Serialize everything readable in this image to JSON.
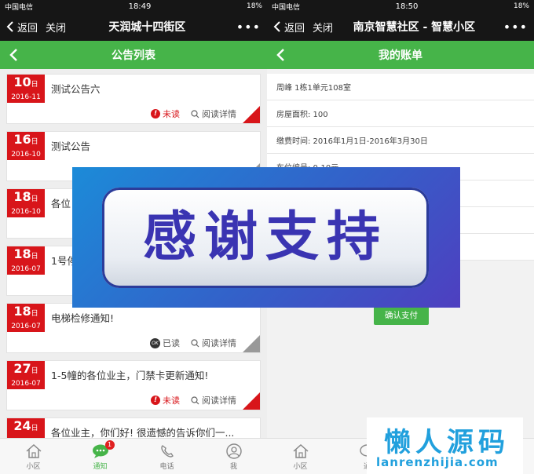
{
  "left": {
    "status": {
      "carrier": "中国电信",
      "time": "18:49",
      "battery": "18%"
    },
    "wx": {
      "back": "返回",
      "close": "关闭",
      "title": "天润城十四街区",
      "more": "•••"
    },
    "header": {
      "title": "公告列表"
    },
    "notices": [
      {
        "day": "10",
        "day_unit": "日",
        "ym": "2016-11",
        "title": "测试公告六",
        "status": "未读",
        "read_link": "阅读详情",
        "state": "unread"
      },
      {
        "day": "16",
        "day_unit": "日",
        "ym": "2016-10",
        "title": "测试公告",
        "status": "",
        "read_link": "",
        "state": "read"
      },
      {
        "day": "18",
        "day_unit": "日",
        "ym": "2016-10",
        "title": "各位",
        "status": "",
        "read_link": "",
        "state": "read"
      },
      {
        "day": "18",
        "day_unit": "日",
        "ym": "2016-07",
        "title": "1号停",
        "status": "",
        "read_link": "",
        "state": "read"
      },
      {
        "day": "18",
        "day_unit": "日",
        "ym": "2016-07",
        "title": "电梯检修通知!",
        "status": "已读",
        "read_link": "阅读详情",
        "state": "read"
      },
      {
        "day": "27",
        "day_unit": "日",
        "ym": "2016-07",
        "title": "1-5幢的各位业主，门禁卡更新通知!",
        "status": "未读",
        "read_link": "阅读详情",
        "state": "unread"
      },
      {
        "day": "24",
        "day_unit": "日",
        "ym": "",
        "title": "各位业主，你们好! 很遗憾的告诉你们一...",
        "status": "",
        "read_link": "",
        "state": "read"
      }
    ],
    "tabs": [
      {
        "label": "小区",
        "icon": "home-icon"
      },
      {
        "label": "通知",
        "icon": "chat-icon",
        "badge": "1"
      },
      {
        "label": "电话",
        "icon": "phone-icon"
      },
      {
        "label": "我",
        "icon": "user-icon"
      }
    ]
  },
  "right": {
    "status": {
      "carrier": "中国电信",
      "time": "18:50",
      "battery": "18%"
    },
    "wx": {
      "back": "返回",
      "close": "关闭",
      "title": "南京智慧社区 - 智慧小区",
      "more": "•••"
    },
    "header": {
      "title": "我的账单"
    },
    "rows": [
      "周峰  1栋1单元108室",
      "房屋面积: 100",
      "缴费时间: 2016年1月1日-2016年3月30日",
      "车位编号: 0-10元",
      "",
      "",
      ""
    ],
    "pay_button": "确认支付",
    "tabs": [
      {
        "label": "小区",
        "icon": "home-icon"
      },
      {
        "label": "通",
        "icon": "chat-icon"
      }
    ]
  },
  "overlay": {
    "text": "感谢支持"
  },
  "watermark": {
    "title": "懒人源码",
    "url": "lanrenzhijia.com"
  },
  "colors": {
    "green": "#46b449",
    "red": "#d8151a",
    "dark": "#161616"
  }
}
